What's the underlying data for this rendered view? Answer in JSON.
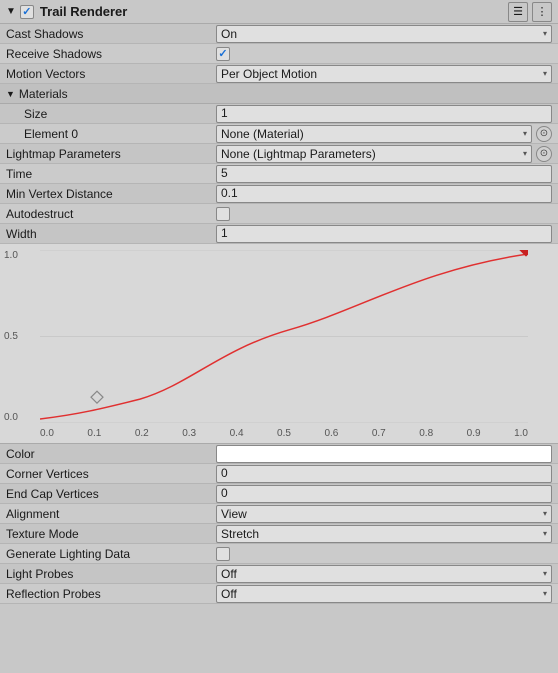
{
  "header": {
    "title": "Trail Renderer",
    "icon_collapse": "▼",
    "icon_check": "✓",
    "btn_menu": "☰",
    "btn_dots": "⋮"
  },
  "rows": [
    {
      "label": "Cast Shadows",
      "type": "dropdown",
      "value": "On"
    },
    {
      "label": "Receive Shadows",
      "type": "checkbox",
      "checked": true
    },
    {
      "label": "Motion Vectors",
      "type": "dropdown",
      "value": "Per Object Motion"
    },
    {
      "label": "Materials",
      "type": "section"
    },
    {
      "label": "Size",
      "type": "text",
      "value": "1",
      "indented": true
    },
    {
      "label": "Element 0",
      "type": "dropdown_circle",
      "value": "None (Material)",
      "indented": true
    },
    {
      "label": "Lightmap Parameters",
      "type": "dropdown_circle",
      "value": "None (Lightmap Parameters)"
    },
    {
      "label": "Time",
      "type": "text",
      "value": "5"
    },
    {
      "label": "Min Vertex Distance",
      "type": "text",
      "value": "0.1"
    },
    {
      "label": "Autodestruct",
      "type": "checkbox",
      "checked": false
    },
    {
      "label": "Width",
      "type": "text",
      "value": "1"
    }
  ],
  "chart": {
    "y_labels": [
      "1.0",
      "0.5",
      "0.0"
    ],
    "x_labels": [
      "0.0",
      "0.1",
      "0.2",
      "0.3",
      "0.4",
      "0.5",
      "0.6",
      "0.7",
      "0.8",
      "0.9",
      "1.0"
    ]
  },
  "rows2": [
    {
      "label": "Color",
      "type": "color",
      "value": ""
    },
    {
      "label": "Corner Vertices",
      "type": "text",
      "value": "0"
    },
    {
      "label": "End Cap Vertices",
      "type": "text",
      "value": "0"
    },
    {
      "label": "Alignment",
      "type": "dropdown",
      "value": "View"
    },
    {
      "label": "Texture Mode",
      "type": "dropdown",
      "value": "Stretch"
    },
    {
      "label": "Generate Lighting Data",
      "type": "checkbox",
      "checked": false
    },
    {
      "label": "Light Probes",
      "type": "dropdown",
      "value": "Off"
    },
    {
      "label": "Reflection Probes",
      "type": "dropdown",
      "value": "Off"
    }
  ]
}
